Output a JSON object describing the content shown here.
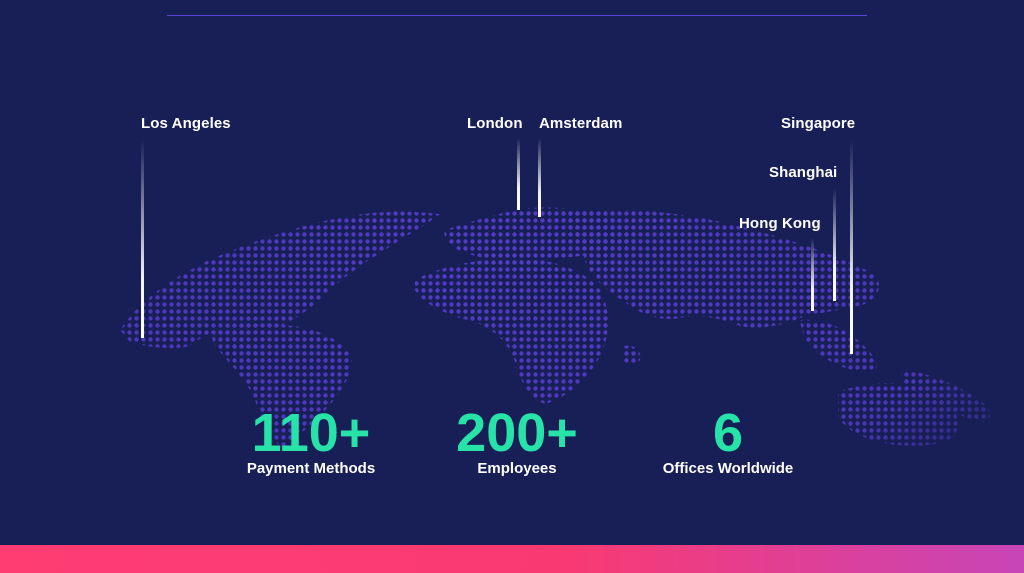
{
  "cities": {
    "los_angeles": "Los Angeles",
    "london": "London",
    "amsterdam": "Amsterdam",
    "singapore": "Singapore",
    "shanghai": "Shanghai",
    "hong_kong": "Hong Kong"
  },
  "stats": [
    {
      "value": "110+",
      "label": "Payment Methods"
    },
    {
      "value": "200+",
      "label": "Employees"
    },
    {
      "value": "6",
      "label": "Offices Worldwide"
    }
  ],
  "colors": {
    "background": "#181f57",
    "accent_green": "#27e3a8",
    "map_dots": "#5a3fd0",
    "bottom_bar_start": "#ff3d73",
    "bottom_bar_end": "#c745b7"
  }
}
